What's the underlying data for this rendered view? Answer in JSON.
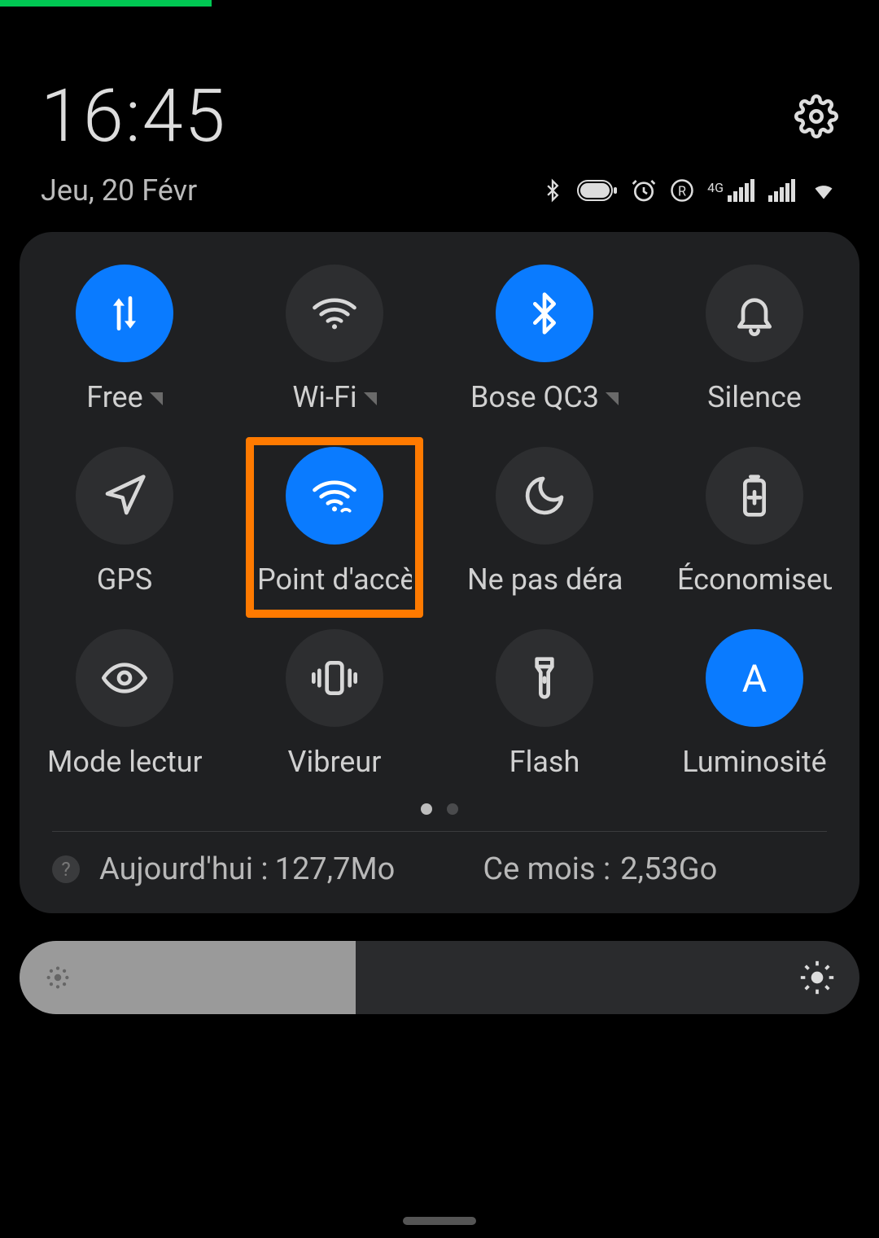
{
  "header": {
    "time": "16:45",
    "date": "Jeu, 20 Févr"
  },
  "status": {
    "network_type": "4G"
  },
  "tiles": [
    {
      "id": "mobile-data",
      "label": "Free",
      "active": true,
      "icon": "data-arrows",
      "expandable": true
    },
    {
      "id": "wifi",
      "label": "Wi-Fi",
      "active": false,
      "icon": "wifi",
      "expandable": true
    },
    {
      "id": "bluetooth",
      "label": "Bose QC3",
      "active": true,
      "icon": "bluetooth",
      "expandable": true
    },
    {
      "id": "silence",
      "label": "Silence",
      "active": false,
      "icon": "bell",
      "expandable": false
    },
    {
      "id": "gps",
      "label": "GPS",
      "active": false,
      "icon": "navigation",
      "expandable": false
    },
    {
      "id": "hotspot",
      "label": "Point d'accè",
      "active": true,
      "icon": "hotspot",
      "expandable": false,
      "highlighted": true
    },
    {
      "id": "dnd",
      "label": "Ne pas déra",
      "active": false,
      "icon": "moon",
      "expandable": false
    },
    {
      "id": "battery",
      "label": "Économiseu",
      "active": false,
      "icon": "battery-plus",
      "expandable": false
    },
    {
      "id": "reading",
      "label": "Mode lecture",
      "active": false,
      "icon": "eye",
      "expandable": false
    },
    {
      "id": "vibrate",
      "label": "Vibreur",
      "active": false,
      "icon": "vibrate",
      "expandable": false
    },
    {
      "id": "flash",
      "label": "Flash",
      "active": false,
      "icon": "flashlight",
      "expandable": false
    },
    {
      "id": "auto-bright",
      "label": "Luminosité ",
      "active": true,
      "icon": "letter-a",
      "expandable": false
    }
  ],
  "usage": {
    "today_label": "Aujourd'hui :",
    "today_value": "127,7Mo",
    "month_label": "Ce mois :",
    "month_value": "2,53Go"
  },
  "brightness": {
    "percent": 40
  },
  "pager": {
    "pages": 2,
    "current": 0
  }
}
